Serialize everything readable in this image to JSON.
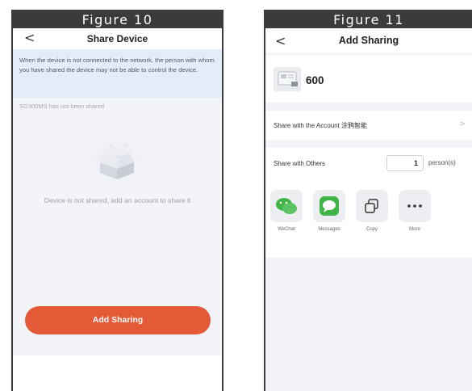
{
  "figure10": {
    "caption": "Figure 10",
    "nav": {
      "back": "<",
      "title": "Share Device"
    },
    "banner": "When the device is not connected to the network, the person with whom you have shared the device may not be able to control the device.",
    "status": "SG300MS has not been shared",
    "empty_text": "Device is not shared, add an account to share it",
    "add_button": "Add Sharing",
    "icons": {
      "back": "chevron-left-icon",
      "empty_box": "open-box-icon"
    },
    "colors": {
      "accent": "#e55a36",
      "banner_bg": "#e3ecf7",
      "page_bg": "#f3f4f8"
    }
  },
  "figure11": {
    "caption": "Figure 11",
    "nav": {
      "back": "<",
      "title": "Add Sharing"
    },
    "device": {
      "name": "600",
      "icon": "device-thumbnail-icon"
    },
    "account_row": {
      "label": "Share with the Account 涂鸦智能",
      "chevron": ">"
    },
    "others_row": {
      "label": "Share with Others",
      "count": "1",
      "unit": "person(s)"
    },
    "share_options": [
      {
        "label": "WeChat",
        "icon": "wechat-icon",
        "color": "#3fb548"
      },
      {
        "label": "Messages",
        "icon": "messages-icon",
        "color": "#3fb548"
      },
      {
        "label": "Copy",
        "icon": "copy-icon",
        "color": "#333333"
      },
      {
        "label": "More",
        "icon": "more-icon",
        "color": "#333333"
      }
    ]
  }
}
